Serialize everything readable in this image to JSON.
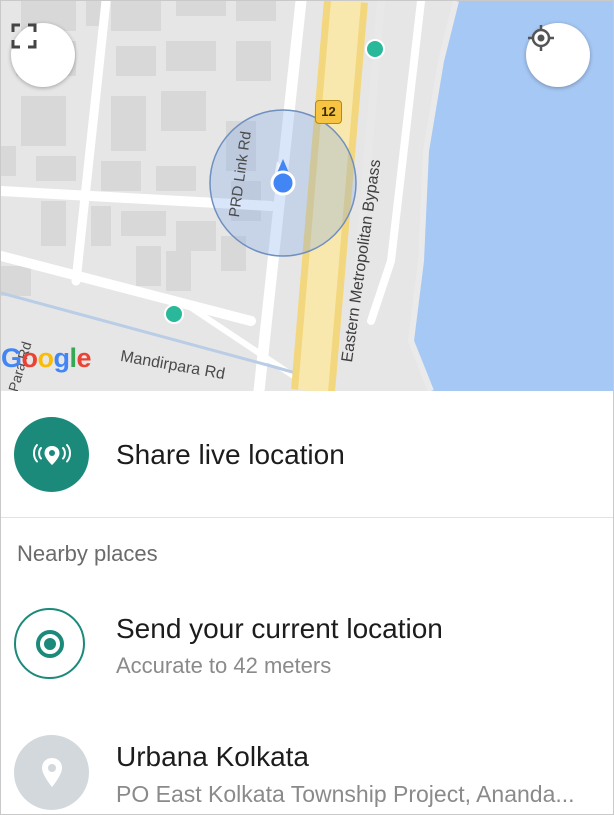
{
  "map": {
    "google_logo": {
      "letters": [
        "G",
        "o",
        "o",
        "g",
        "l",
        "e"
      ],
      "colors": [
        "#4285F4",
        "#EA4335",
        "#FBBC05",
        "#4285F4",
        "#34A853",
        "#EA4335"
      ]
    },
    "road_labels": {
      "prd_link_rd": "PRD Link Rd",
      "eastern_metropolitan_bypass": "Eastern Metropolitan Bypass",
      "mandirpara_rd": "Mandirpara Rd",
      "para_rd": "Para Rd"
    },
    "route_shield": "12",
    "colors": {
      "water": "#a6c8f5",
      "highway": "#f7dc8a",
      "my_location": "#4285F4",
      "poi": "#29b89a"
    }
  },
  "share_live": {
    "label": "Share live location",
    "icon": "live-location-icon"
  },
  "nearby": {
    "header": "Nearby places"
  },
  "current_location": {
    "title": "Send your current location",
    "subtitle": "Accurate to 42 meters",
    "icon": "current-location-icon"
  },
  "places": [
    {
      "title": "Urbana Kolkata",
      "subtitle": "PO East Kolkata Township Project, Ananda...",
      "icon": "place-pin-icon"
    }
  ],
  "accent": "#1b8a7a"
}
